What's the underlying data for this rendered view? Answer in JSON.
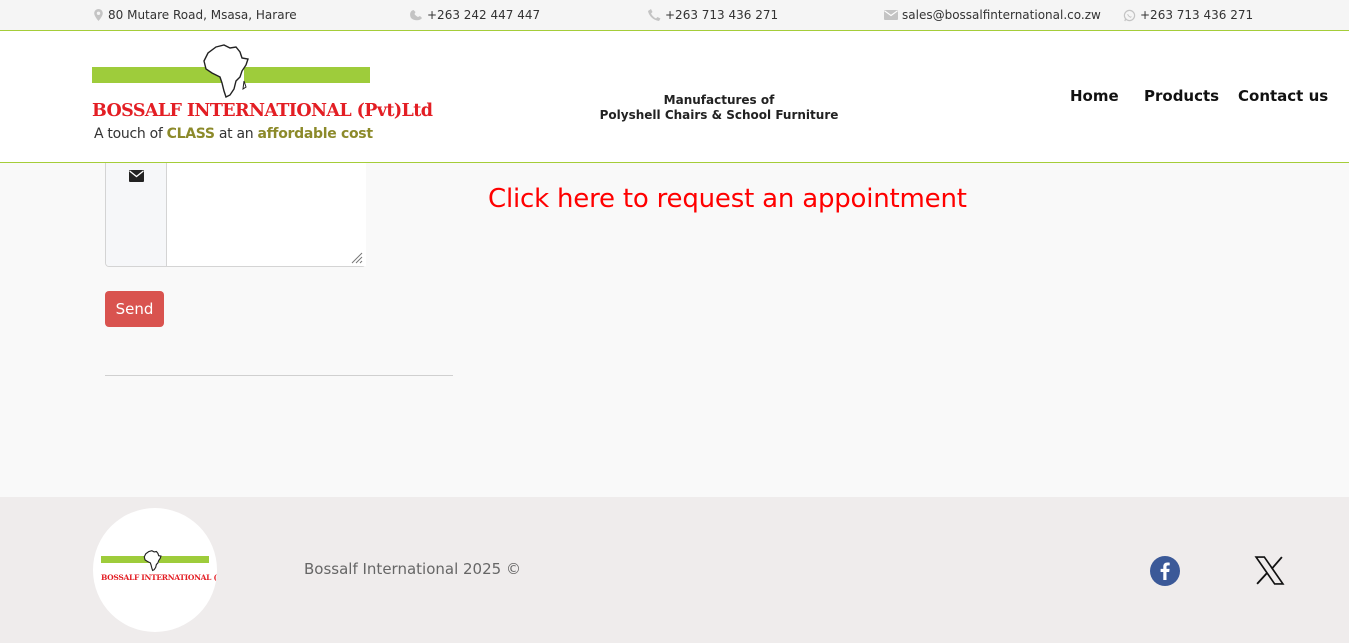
{
  "topbar": {
    "address": "80 Mutare Road, Msasa, Harare",
    "phone_landline": "+263 242 447 447",
    "phone_mobile": "+263 713 436 271",
    "email": "sales@bossalfinternational.co.zw",
    "whatsapp": "+263 713 436 271"
  },
  "logo": {
    "brand": "BOSSALF INTERNATIONAL (Pvt)Ltd",
    "tagline_pre": "A touch of ",
    "tagline_class": "CLASS",
    "tagline_mid": " at an ",
    "tagline_post": "affordable cost"
  },
  "slogan": {
    "line1": "Manufactures of",
    "line2": "Polyshell Chairs & School Furniture"
  },
  "nav": {
    "home": "Home",
    "products": "Products",
    "contact": "Contact us"
  },
  "form": {
    "message_value": "",
    "send_label": "Send"
  },
  "appointment_link": "Click here to request an appointment",
  "footer": {
    "logo_brand": "BOSSALF INTERNATIONAL (Pvt)Ltd",
    "copyright": "Bossalf International 2025 ©"
  },
  "icons": {
    "address": "map-marker-icon",
    "landline": "phone-icon",
    "mobile": "mobile-phone-icon",
    "email": "envelope-icon",
    "whatsapp": "whatsapp-icon",
    "message": "envelope-icon",
    "facebook": "facebook-icon",
    "x": "x-twitter-icon"
  },
  "colors": {
    "accent_green": "#9ecc3b",
    "brand_red": "#e31e24",
    "link_red": "#ff0000",
    "send_button": "#d9534f",
    "facebook_blue": "#3b5998"
  }
}
